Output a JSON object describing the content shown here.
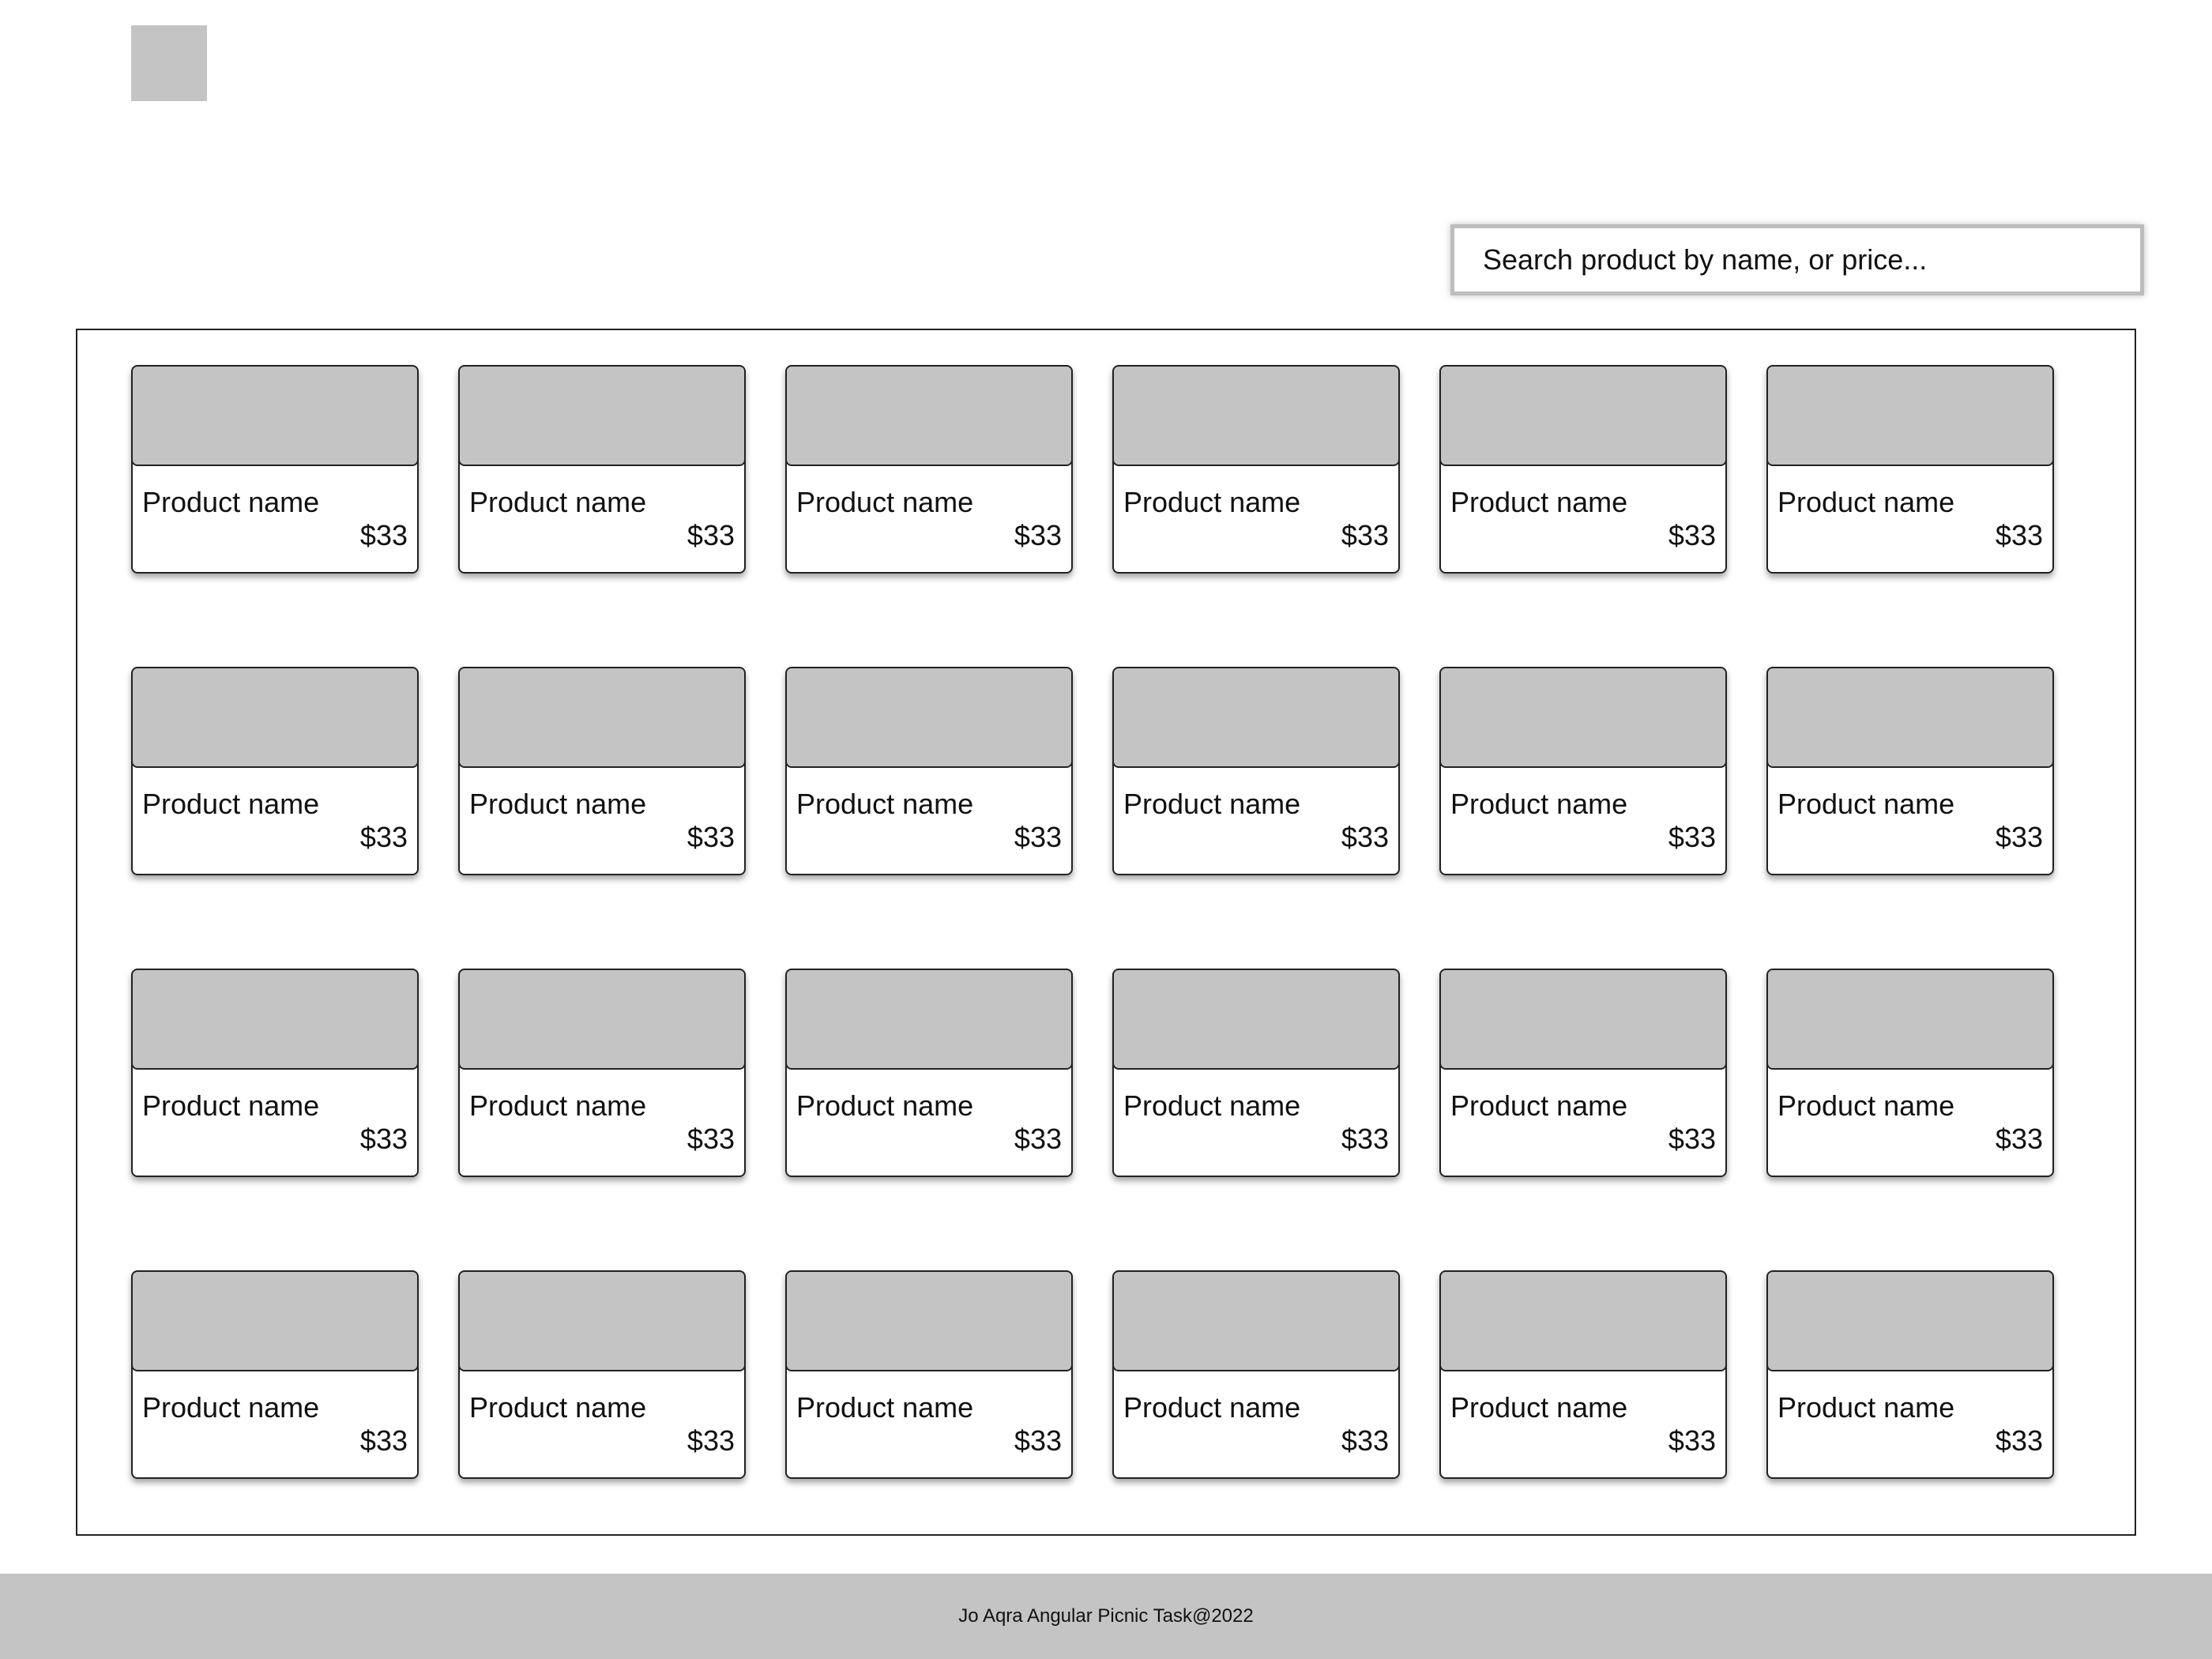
{
  "search": {
    "placeholder": "Search product by name, or price..."
  },
  "products": [
    {
      "name": "Product name",
      "price": "$33"
    },
    {
      "name": "Product name",
      "price": "$33"
    },
    {
      "name": "Product name",
      "price": "$33"
    },
    {
      "name": "Product name",
      "price": "$33"
    },
    {
      "name": "Product name",
      "price": "$33"
    },
    {
      "name": "Product name",
      "price": "$33"
    },
    {
      "name": "Product name",
      "price": "$33"
    },
    {
      "name": "Product name",
      "price": "$33"
    },
    {
      "name": "Product name",
      "price": "$33"
    },
    {
      "name": "Product name",
      "price": "$33"
    },
    {
      "name": "Product name",
      "price": "$33"
    },
    {
      "name": "Product name",
      "price": "$33"
    },
    {
      "name": "Product name",
      "price": "$33"
    },
    {
      "name": "Product name",
      "price": "$33"
    },
    {
      "name": "Product name",
      "price": "$33"
    },
    {
      "name": "Product name",
      "price": "$33"
    },
    {
      "name": "Product name",
      "price": "$33"
    },
    {
      "name": "Product name",
      "price": "$33"
    },
    {
      "name": "Product name",
      "price": "$33"
    },
    {
      "name": "Product name",
      "price": "$33"
    },
    {
      "name": "Product name",
      "price": "$33"
    },
    {
      "name": "Product name",
      "price": "$33"
    },
    {
      "name": "Product name",
      "price": "$33"
    },
    {
      "name": "Product name",
      "price": "$33"
    }
  ],
  "footer": {
    "text": "Jo Aqra Angular Picnic Task@2022"
  },
  "colors": {
    "placeholder_gray": "#c4c4c4",
    "border": "#222222",
    "background": "#ffffff"
  }
}
